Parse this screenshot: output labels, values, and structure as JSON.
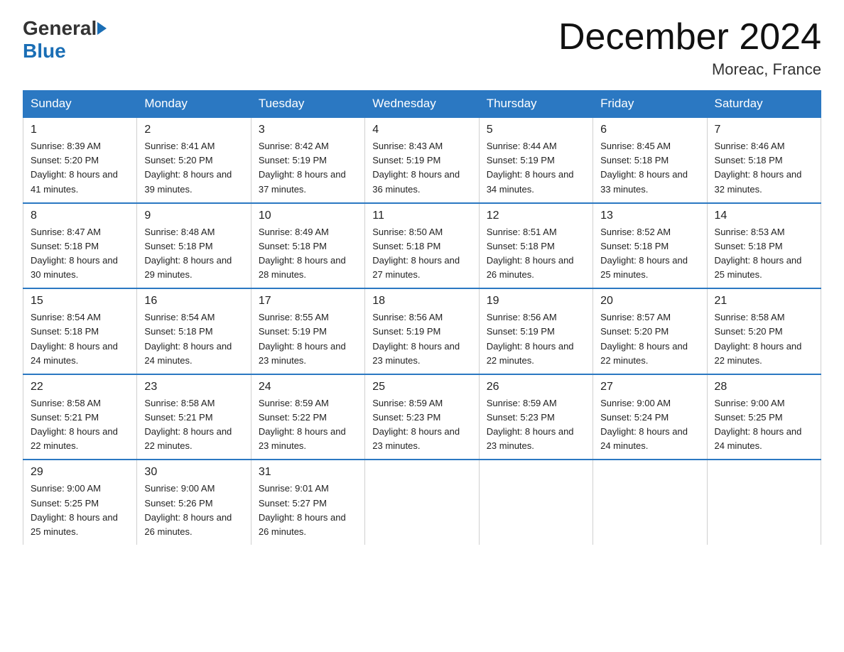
{
  "header": {
    "logo_general": "General",
    "logo_blue": "Blue",
    "month_title": "December 2024",
    "location": "Moreac, France"
  },
  "weekdays": [
    "Sunday",
    "Monday",
    "Tuesday",
    "Wednesday",
    "Thursday",
    "Friday",
    "Saturday"
  ],
  "weeks": [
    [
      {
        "day": "1",
        "sunrise": "8:39 AM",
        "sunset": "5:20 PM",
        "daylight": "8 hours and 41 minutes."
      },
      {
        "day": "2",
        "sunrise": "8:41 AM",
        "sunset": "5:20 PM",
        "daylight": "8 hours and 39 minutes."
      },
      {
        "day": "3",
        "sunrise": "8:42 AM",
        "sunset": "5:19 PM",
        "daylight": "8 hours and 37 minutes."
      },
      {
        "day": "4",
        "sunrise": "8:43 AM",
        "sunset": "5:19 PM",
        "daylight": "8 hours and 36 minutes."
      },
      {
        "day": "5",
        "sunrise": "8:44 AM",
        "sunset": "5:19 PM",
        "daylight": "8 hours and 34 minutes."
      },
      {
        "day": "6",
        "sunrise": "8:45 AM",
        "sunset": "5:18 PM",
        "daylight": "8 hours and 33 minutes."
      },
      {
        "day": "7",
        "sunrise": "8:46 AM",
        "sunset": "5:18 PM",
        "daylight": "8 hours and 32 minutes."
      }
    ],
    [
      {
        "day": "8",
        "sunrise": "8:47 AM",
        "sunset": "5:18 PM",
        "daylight": "8 hours and 30 minutes."
      },
      {
        "day": "9",
        "sunrise": "8:48 AM",
        "sunset": "5:18 PM",
        "daylight": "8 hours and 29 minutes."
      },
      {
        "day": "10",
        "sunrise": "8:49 AM",
        "sunset": "5:18 PM",
        "daylight": "8 hours and 28 minutes."
      },
      {
        "day": "11",
        "sunrise": "8:50 AM",
        "sunset": "5:18 PM",
        "daylight": "8 hours and 27 minutes."
      },
      {
        "day": "12",
        "sunrise": "8:51 AM",
        "sunset": "5:18 PM",
        "daylight": "8 hours and 26 minutes."
      },
      {
        "day": "13",
        "sunrise": "8:52 AM",
        "sunset": "5:18 PM",
        "daylight": "8 hours and 25 minutes."
      },
      {
        "day": "14",
        "sunrise": "8:53 AM",
        "sunset": "5:18 PM",
        "daylight": "8 hours and 25 minutes."
      }
    ],
    [
      {
        "day": "15",
        "sunrise": "8:54 AM",
        "sunset": "5:18 PM",
        "daylight": "8 hours and 24 minutes."
      },
      {
        "day": "16",
        "sunrise": "8:54 AM",
        "sunset": "5:18 PM",
        "daylight": "8 hours and 24 minutes."
      },
      {
        "day": "17",
        "sunrise": "8:55 AM",
        "sunset": "5:19 PM",
        "daylight": "8 hours and 23 minutes."
      },
      {
        "day": "18",
        "sunrise": "8:56 AM",
        "sunset": "5:19 PM",
        "daylight": "8 hours and 23 minutes."
      },
      {
        "day": "19",
        "sunrise": "8:56 AM",
        "sunset": "5:19 PM",
        "daylight": "8 hours and 22 minutes."
      },
      {
        "day": "20",
        "sunrise": "8:57 AM",
        "sunset": "5:20 PM",
        "daylight": "8 hours and 22 minutes."
      },
      {
        "day": "21",
        "sunrise": "8:58 AM",
        "sunset": "5:20 PM",
        "daylight": "8 hours and 22 minutes."
      }
    ],
    [
      {
        "day": "22",
        "sunrise": "8:58 AM",
        "sunset": "5:21 PM",
        "daylight": "8 hours and 22 minutes."
      },
      {
        "day": "23",
        "sunrise": "8:58 AM",
        "sunset": "5:21 PM",
        "daylight": "8 hours and 22 minutes."
      },
      {
        "day": "24",
        "sunrise": "8:59 AM",
        "sunset": "5:22 PM",
        "daylight": "8 hours and 23 minutes."
      },
      {
        "day": "25",
        "sunrise": "8:59 AM",
        "sunset": "5:23 PM",
        "daylight": "8 hours and 23 minutes."
      },
      {
        "day": "26",
        "sunrise": "8:59 AM",
        "sunset": "5:23 PM",
        "daylight": "8 hours and 23 minutes."
      },
      {
        "day": "27",
        "sunrise": "9:00 AM",
        "sunset": "5:24 PM",
        "daylight": "8 hours and 24 minutes."
      },
      {
        "day": "28",
        "sunrise": "9:00 AM",
        "sunset": "5:25 PM",
        "daylight": "8 hours and 24 minutes."
      }
    ],
    [
      {
        "day": "29",
        "sunrise": "9:00 AM",
        "sunset": "5:25 PM",
        "daylight": "8 hours and 25 minutes."
      },
      {
        "day": "30",
        "sunrise": "9:00 AM",
        "sunset": "5:26 PM",
        "daylight": "8 hours and 26 minutes."
      },
      {
        "day": "31",
        "sunrise": "9:01 AM",
        "sunset": "5:27 PM",
        "daylight": "8 hours and 26 minutes."
      },
      null,
      null,
      null,
      null
    ]
  ],
  "sunrise_label": "Sunrise:",
  "sunset_label": "Sunset:",
  "daylight_label": "Daylight:"
}
